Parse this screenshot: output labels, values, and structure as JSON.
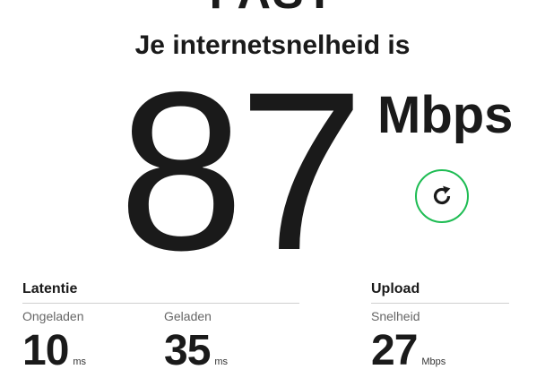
{
  "header": {
    "logo_text": "FAST",
    "headline": "Je internetsnelheid is"
  },
  "download": {
    "value": "87",
    "units": "Mbps",
    "refresh_icon": "refresh-icon"
  },
  "latency": {
    "title": "Latentie",
    "unloaded": {
      "label": "Ongeladen",
      "value": "10",
      "unit": "ms"
    },
    "loaded": {
      "label": "Geladen",
      "value": "35",
      "unit": "ms"
    }
  },
  "upload": {
    "title": "Upload",
    "speed": {
      "label": "Snelheid",
      "value": "27",
      "unit": "Mbps"
    }
  },
  "colors": {
    "accent_green": "#1ebc53",
    "text": "#1a1a1a",
    "muted": "#666666",
    "divider": "#d0d0d0"
  }
}
